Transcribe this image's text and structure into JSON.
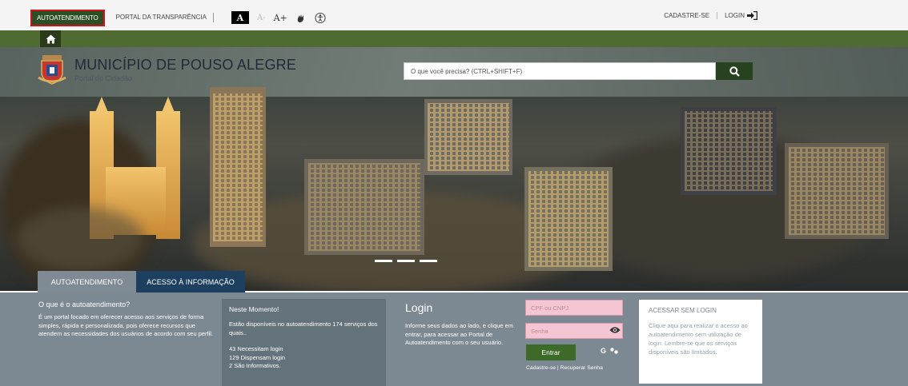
{
  "topbar": {
    "autoatendimento": "AUTOATENDIMENTO",
    "transparencia": "PORTAL DA TRANSPARÊNCIA",
    "font_normal": "A",
    "font_minus": "A-",
    "font_plus": "A+",
    "cadastre": "CADASTRE-SE",
    "login": "LOGIN"
  },
  "header": {
    "title": "MUNICÍPIO DE POUSO ALEGRE",
    "subtitle": "Portal do Cidadão",
    "search_placeholder": "O que você precisa? (CTRL+SHIFT+F)"
  },
  "tabs": [
    {
      "label": "AUTOATENDIMENTO"
    },
    {
      "label": "ACESSO À INFORMAÇÃO"
    }
  ],
  "about": {
    "heading": "O que é o autoatendimento?",
    "text": "É um portal focado em oferecer acesso aos serviços de forma simples, rápida e personalizada, pois oferece recursos que atendem as necessidades dos usuários de acordo com seu perfil."
  },
  "moment": {
    "heading": "Neste Momento!",
    "text": "Estão disponíveis no autoatendimento 174 serviços dos quais..",
    "items": [
      "43 Necessitam login",
      "129 Dispensam login",
      "2 São Informativos."
    ]
  },
  "login": {
    "heading": "Login",
    "text": "Informe seus dados ao lado, e clique em entrar, para acessar ao Portal de Autoatendimento com o seu usuário.",
    "cpf_placeholder": "CPF ou CNPJ",
    "senha_placeholder": "Senha",
    "submit": "Entrar",
    "google": "G",
    "cadastre": "Cadastre-se",
    "separator": "|",
    "recuperar": "Recuperar Senha"
  },
  "no_login": {
    "heading": "ACESSAR SEM LOGIN",
    "text": "Clique aqui para realizar o acesso ao autoatendimento sem utilização de login. Lembre-se que os serviços disponíveis são limitados."
  }
}
